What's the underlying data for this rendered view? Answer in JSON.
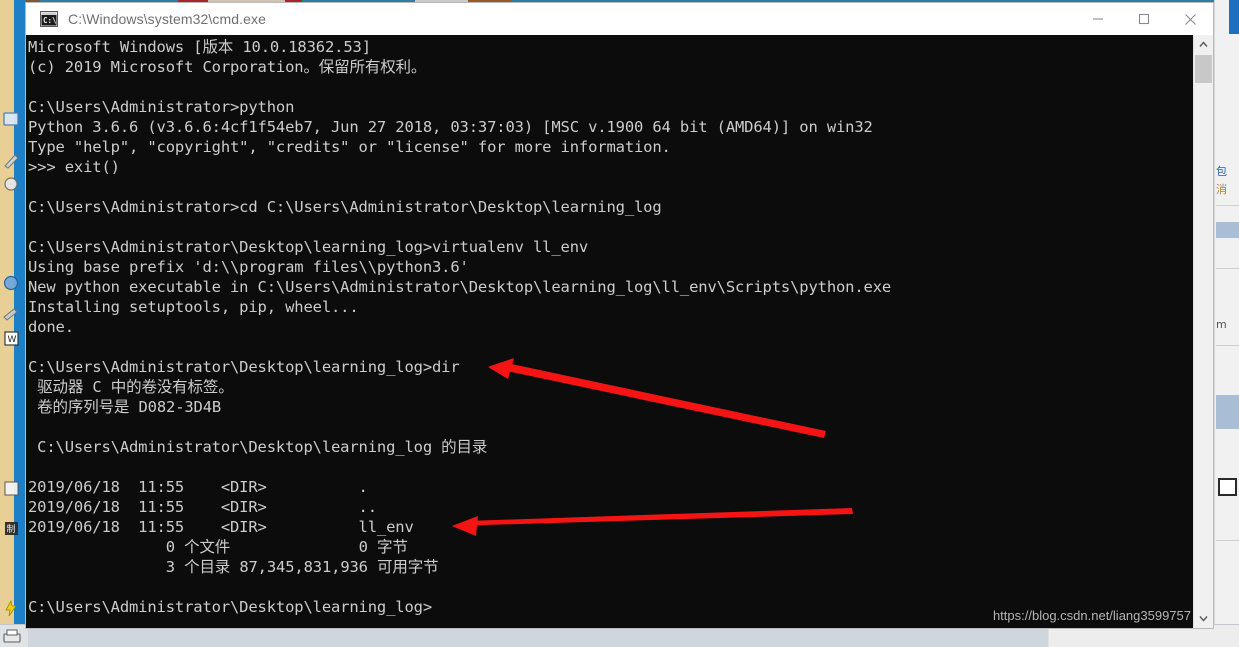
{
  "window": {
    "title": "C:\\Windows\\system32\\cmd.exe",
    "icon": "cmd-console-icon",
    "bg_color": "#0c0c0c",
    "fg_color": "#cccccc",
    "titlebar_color": "#ffffff",
    "titlebar_text_color": "#6f6f6f",
    "controls": {
      "minimize_label": "Minimize",
      "maximize_label": "Maximize",
      "close_label": "Close"
    }
  },
  "console": {
    "lines": [
      "Microsoft Windows [版本 10.0.18362.53]",
      "(c) 2019 Microsoft Corporation。保留所有权利。",
      "",
      "C:\\Users\\Administrator>python",
      "Python 3.6.6 (v3.6.6:4cf1f54eb7, Jun 27 2018, 03:37:03) [MSC v.1900 64 bit (AMD64)] on win32",
      "Type \"help\", \"copyright\", \"credits\" or \"license\" for more information.",
      ">>> exit()",
      "",
      "C:\\Users\\Administrator>cd C:\\Users\\Administrator\\Desktop\\learning_log",
      "",
      "C:\\Users\\Administrator\\Desktop\\learning_log>virtualenv ll_env",
      "Using base prefix 'd:\\\\program files\\\\python3.6'",
      "New python executable in C:\\Users\\Administrator\\Desktop\\learning_log\\ll_env\\Scripts\\python.exe",
      "Installing setuptools, pip, wheel...",
      "done.",
      "",
      "C:\\Users\\Administrator\\Desktop\\learning_log>dir",
      " 驱动器 C 中的卷没有标签。",
      " 卷的序列号是 D082-3D4B",
      "",
      " C:\\Users\\Administrator\\Desktop\\learning_log 的目录",
      "",
      "2019/06/18  11:55    <DIR>          .",
      "2019/06/18  11:55    <DIR>          ..",
      "2019/06/18  11:55    <DIR>          ll_env",
      "               0 个文件              0 字节",
      "               3 个目录 87,345,831,936 可用字节",
      "",
      "C:\\Users\\Administrator\\Desktop\\learning_log>"
    ],
    "commands_entered": [
      "python",
      "exit()",
      "cd C:\\Users\\Administrator\\Desktop\\learning_log",
      "virtualenv ll_env",
      "dir"
    ],
    "directory_listing": {
      "volume_label_line": "驱动器 C 中的卷没有标签。",
      "serial_line": "卷的序列号是 D082-3D4B",
      "serial_number": "D082-3D4B",
      "path_header": " C:\\Users\\Administrator\\Desktop\\learning_log 的目录",
      "entries": [
        {
          "date": "2019/06/18",
          "time": "11:55",
          "type": "<DIR>",
          "name": "."
        },
        {
          "date": "2019/06/18",
          "time": "11:55",
          "type": "<DIR>",
          "name": ".."
        },
        {
          "date": "2019/06/18",
          "time": "11:55",
          "type": "<DIR>",
          "name": "ll_env"
        }
      ],
      "file_count": "0",
      "file_count_text": "0 个文件",
      "bytes_text": "0 字节",
      "dir_count": "3",
      "dir_count_text": "3 个目录",
      "free_bytes": "87,345,831,936",
      "free_bytes_text": "87,345,831,936 可用字节"
    },
    "python_version": "3.6.6",
    "windows_version": "10.0.18362.53",
    "prompt_final": "C:\\Users\\Administrator\\Desktop\\learning_log>"
  },
  "annotations": {
    "arrow_color": "#f41414",
    "arrows": [
      {
        "name": "arrow-pointing-to-dir-command",
        "target": "dir"
      },
      {
        "name": "arrow-pointing-to-ll-env-folder",
        "target": "ll_env"
      }
    ]
  },
  "scrollbar": {
    "up_arrow": "▲",
    "down_arrow": "▼",
    "thumb_color": "#c8c8c8",
    "track_color": "#f0f0f0"
  },
  "watermark": {
    "text": "https://blog.csdn.net/liang3599757",
    "color": "#b5b5b5"
  },
  "background": {
    "right_snippets": [
      "包",
      "消",
      "m",
      ""
    ],
    "accent_blue": "#1d7fc6"
  }
}
